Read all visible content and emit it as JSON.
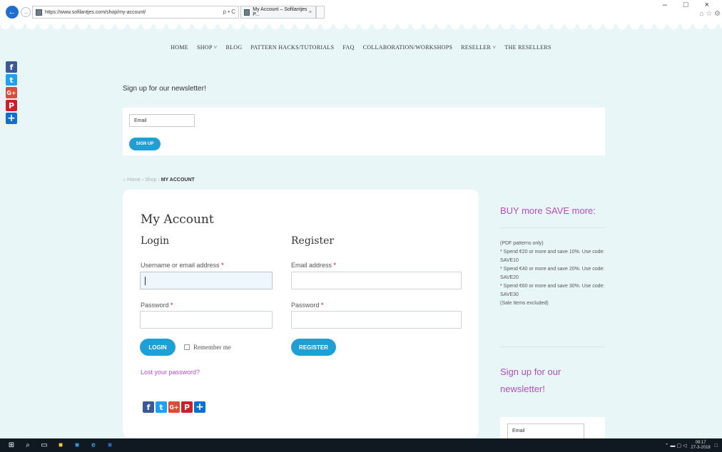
{
  "browser": {
    "back_icon": "arrow-left-icon",
    "url": "https://www.sofilantjes.com/shop/my-account/",
    "url_tools": "ρ • C",
    "tab_title": "My Account – Sofilantjes P...",
    "tab_close": "×",
    "window_controls": "– □ ×",
    "toolbar_icons": "⌂ ☆ ⚙"
  },
  "nav": {
    "items": [
      "HOME",
      "SHOP ˅",
      "BLOG",
      "PATTERN HACKS/TUTORIALS",
      "FAQ",
      "COLLABORATION/WORKSHOPS",
      "RESELLER ˅",
      "THE RESELLERS"
    ]
  },
  "social": {
    "facebook": "f",
    "twitter": "t",
    "googleplus": "G+",
    "pinterest": "P",
    "share": "+"
  },
  "newsletter": {
    "title": "Sign up for our newsletter!",
    "email_placeholder": "Email",
    "button": "SIGN UP"
  },
  "breadcrumb": {
    "home": "⌂ Home",
    "sep": "›",
    "shop": "Shop",
    "current": "MY ACCOUNT"
  },
  "account": {
    "title": "My Account",
    "login": {
      "heading": "Login",
      "username_label": "Username or email address",
      "password_label": "Password",
      "required": "*",
      "button": "LOGIN",
      "remember": "Remember me",
      "lost": "Lost your password?"
    },
    "register": {
      "heading": "Register",
      "email_label": "Email address",
      "password_label": "Password",
      "required": "*",
      "button": "REGISTER"
    }
  },
  "sidebar": {
    "promo_title": "BUY more SAVE more:",
    "promo_lines": [
      "(PDF patterns only)",
      "* Spend €20 or more and save 10%. Use code: SAVE10",
      "* Spend €40 or more and save 20%. Use code: SAVE20",
      "* Spend €60 or more and save 30%. Use code: SAVE30",
      "(Sale Items excluded)"
    ],
    "newsletter_title": "Sign up for our newsletter!",
    "email_placeholder": "Email"
  },
  "taskbar": {
    "time": "09:17",
    "date": "27-3-2018"
  },
  "colors": {
    "accent": "#1ea0d6",
    "link": "#b04fc0",
    "background": "#e9f6f7"
  }
}
